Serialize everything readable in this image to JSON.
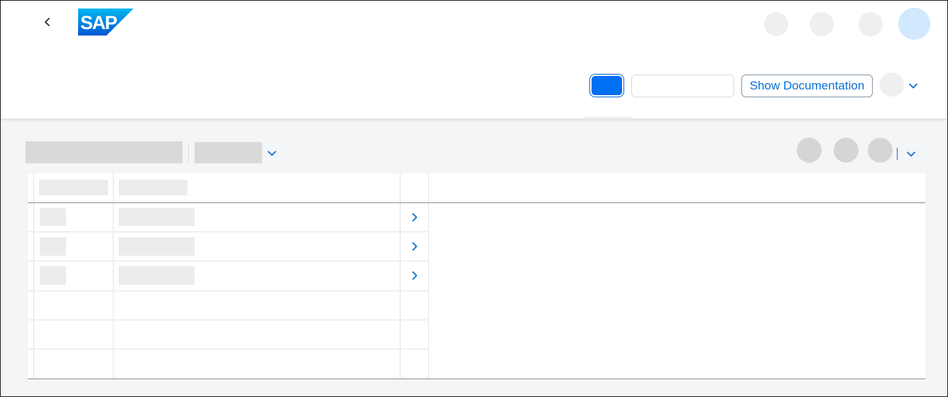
{
  "header": {
    "logo_text": "SAP",
    "documentation_button_label": "Show Documentation"
  },
  "colors": {
    "brand": "#0070f2",
    "link": "#0a6ed1",
    "placeholder": "#d9d9d9",
    "avatar": "#d1e8ff"
  },
  "icons": {
    "back": "chevron-left-icon",
    "dropdown": "chevron-down-icon",
    "row_nav": "chevron-right-icon"
  },
  "table": {
    "filled_rows": 3,
    "empty_rows": 3
  }
}
